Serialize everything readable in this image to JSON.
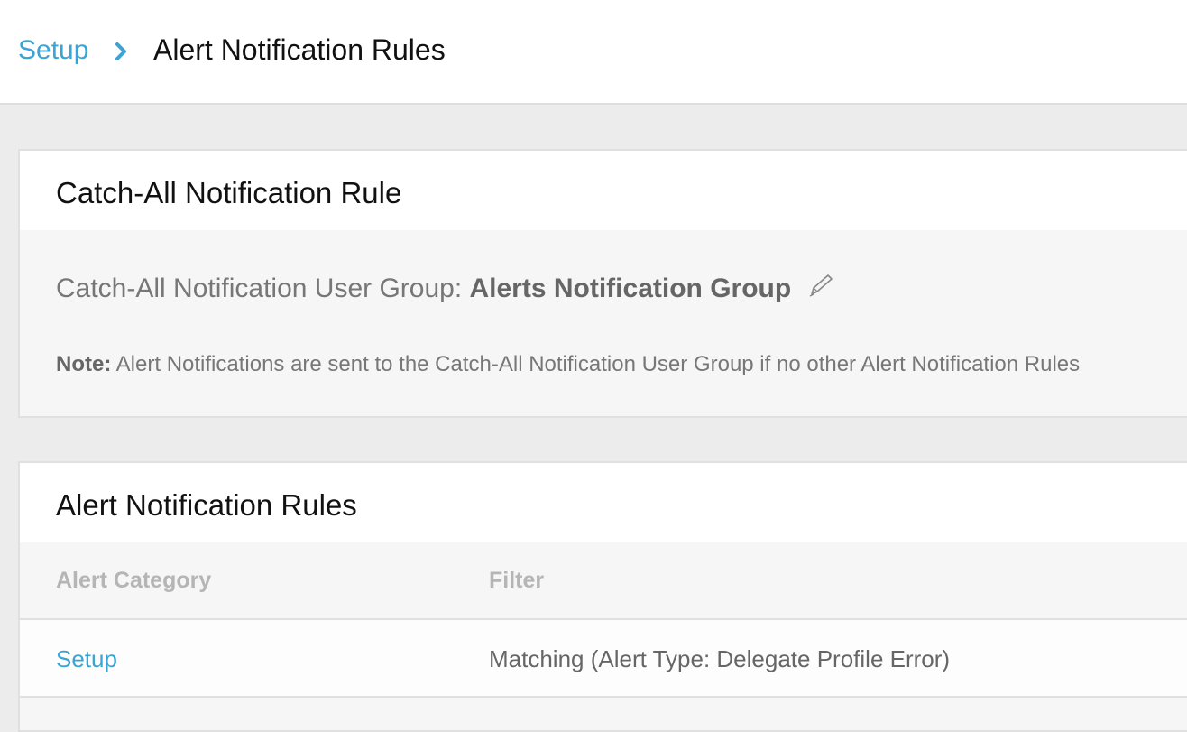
{
  "breadcrumb": {
    "parent": "Setup",
    "current": "Alert Notification Rules"
  },
  "catch_all": {
    "title": "Catch-All Notification Rule",
    "group_label": "Catch-All Notification User Group: ",
    "group_value": "Alerts Notification Group",
    "note_label": "Note:",
    "note_text": " Alert Notifications are sent to the Catch-All Notification User Group if no other Alert Notification Rules"
  },
  "rules": {
    "title": "Alert Notification Rules",
    "columns": [
      "Alert Category",
      "Filter"
    ],
    "rows": [
      {
        "category": "Setup",
        "filter": "Matching (Alert Type: Delegate Profile Error)"
      }
    ]
  },
  "icons": {
    "breadcrumb_separator": "chevron-right-icon",
    "edit": "pencil-icon"
  },
  "colors": {
    "link": "#3aa4d4",
    "background": "#ececec",
    "muted_text": "#777777",
    "header_text": "#b5b5b5"
  }
}
